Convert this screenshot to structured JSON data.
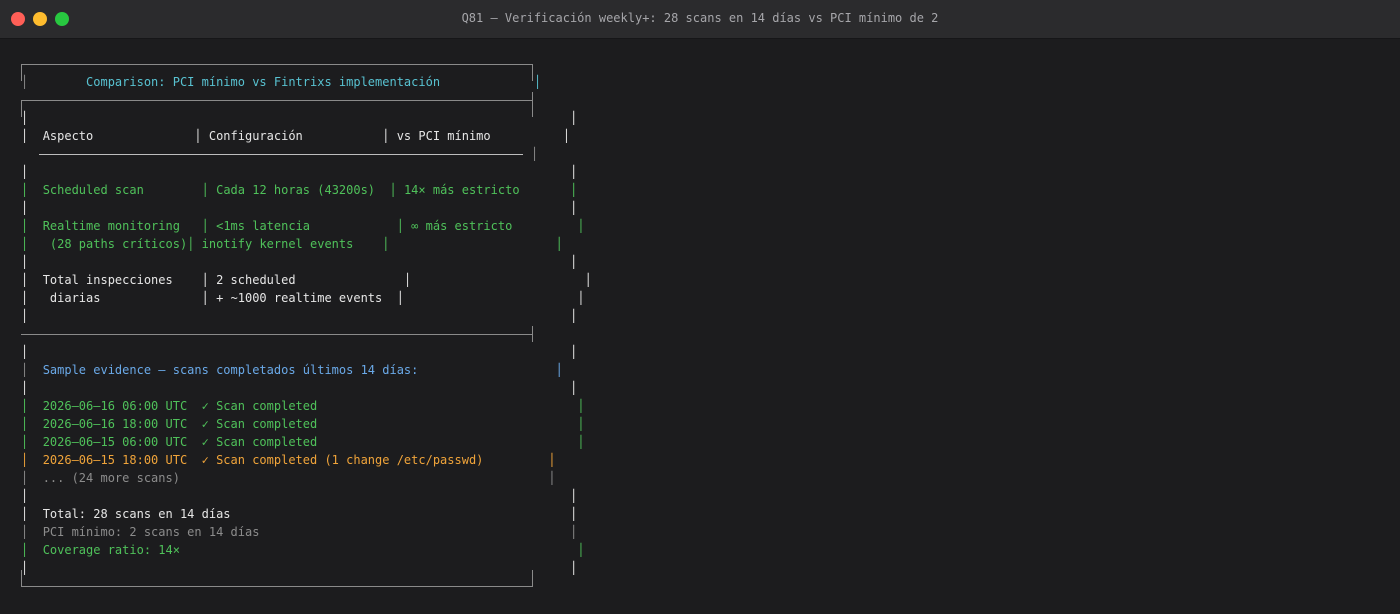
{
  "window": {
    "title": "Q81 — Verificación weekly+: 28 scans en 14 días vs PCI mínimo de 2"
  },
  "box": {
    "heading": "Comparison: PCI mínimo vs Fintrixs implementación",
    "table": {
      "headers": [
        "Aspecto",
        "Configuración",
        "vs PCI mínimo"
      ],
      "rows": [
        {
          "aspect": "Scheduled scan",
          "config": "Cada 12 horas (43200s)",
          "vs": "14× más estricto"
        },
        {
          "aspect": "Realtime monitoring",
          "config": "<1ms latencia",
          "vs": "∞ más estricto"
        },
        {
          "aspect": " (28 paths críticos)",
          "config": "inotify kernel events",
          "vs": ""
        },
        {
          "aspect": "Total inspecciones",
          "config": "2 scheduled",
          "vs": ""
        },
        {
          "aspect": " diarias",
          "config": "+ ~1000 realtime events",
          "vs": ""
        }
      ]
    },
    "evidence": {
      "heading": "Sample evidence — scans completados últimos 14 días:",
      "entries": [
        "2026–06–16 06:00 UTC  ✓ Scan completed",
        "2026–06–16 18:00 UTC  ✓ Scan completed",
        "2026–06–15 06:00 UTC  ✓ Scan completed",
        "2026–06–15 18:00 UTC  ✓ Scan completed (1 change /etc/passwd)"
      ],
      "more": "... (24 more scans)"
    },
    "summary": {
      "total": "Total: 28 scans en 14 días",
      "pci": "PCI mínimo: 2 scans en 14 días",
      "coverage": "Coverage ratio: 14×"
    }
  },
  "colors": {
    "background": "#1c1c1e",
    "green": "#4fc15a",
    "blue": "#6aa9e8",
    "cyan": "#58c2d1",
    "orange": "#f0a43a",
    "gray": "#8c8c8c"
  }
}
